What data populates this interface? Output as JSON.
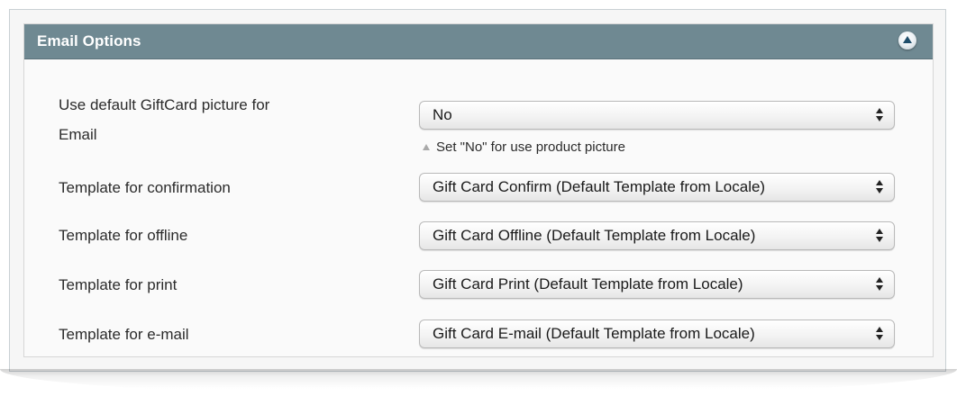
{
  "section": {
    "title": "Email Options"
  },
  "rows": [
    {
      "label_line1": "Use default GiftCard picture for",
      "label_line2": "Email",
      "value": "No",
      "note": "Set \"No\" for use product picture"
    },
    {
      "label": "Template for confirmation",
      "value": "Gift Card Confirm (Default Template from Locale)"
    },
    {
      "label": "Template for offline",
      "value": "Gift Card Offline (Default Template from Locale)"
    },
    {
      "label": "Template for print",
      "value": "Gift Card Print (Default Template from Locale)"
    },
    {
      "label": "Template for e-mail",
      "value": "Gift Card E-mail (Default Template from Locale)"
    }
  ],
  "icons": {
    "collapse": "chevron-up-circle-icon",
    "note": "triangle-up-icon",
    "select_arrows": "select-updown-icon"
  },
  "colors": {
    "header_bg": "#6f8992",
    "header_text": "#ffffff",
    "panel_bg": "#fafafa"
  }
}
